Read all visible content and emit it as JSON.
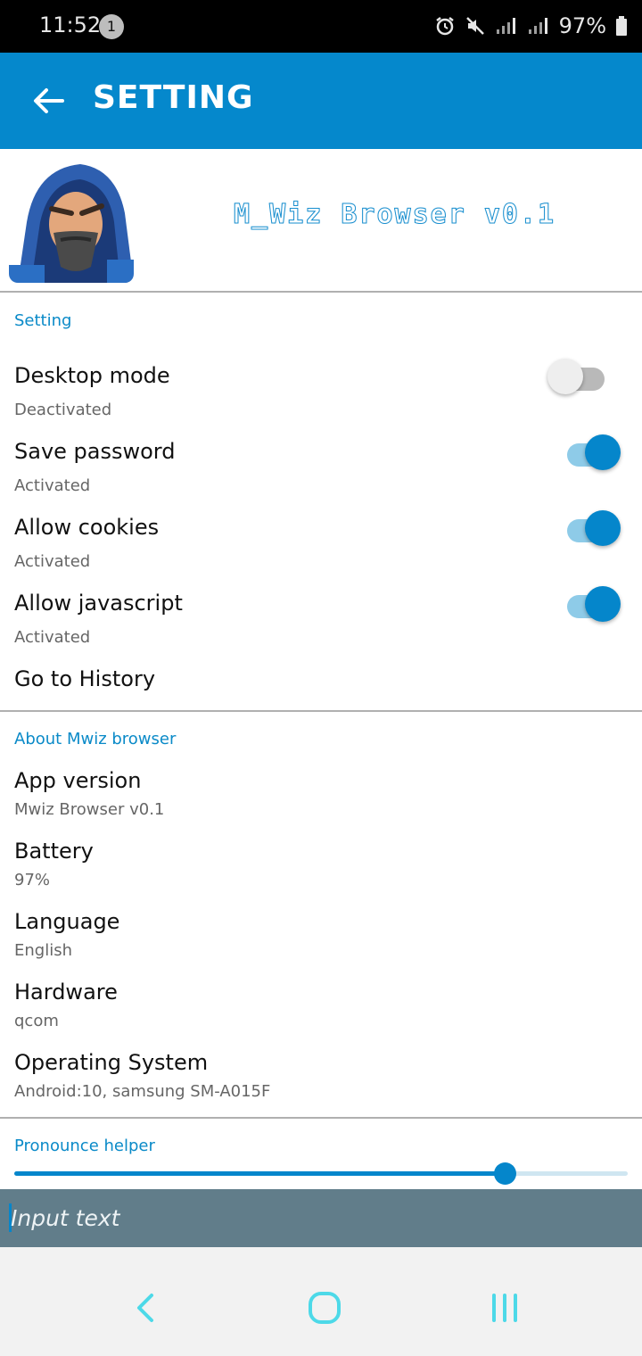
{
  "status_bar": {
    "time": "11:52",
    "notification_count": "1",
    "battery_text": "97%",
    "icons": [
      "alarm-icon",
      "mute-icon",
      "signal-icon",
      "signal-icon",
      "battery-icon"
    ]
  },
  "app_bar": {
    "title": "SETTING",
    "back_icon": "arrow-left-icon",
    "color": "#0588cc"
  },
  "header": {
    "brand_name": "M_Wiz Browser",
    "brand_version": "v0.1"
  },
  "settings_section": {
    "title": "Setting",
    "items": [
      {
        "title": "Desktop mode",
        "subtitle": "Deactivated",
        "enabled": false
      },
      {
        "title": "Save password",
        "subtitle": "Activated",
        "enabled": true
      },
      {
        "title": "Allow cookies",
        "subtitle": "Activated",
        "enabled": true
      },
      {
        "title": "Allow javascript",
        "subtitle": "Activated",
        "enabled": true
      }
    ],
    "history_label": "Go to History"
  },
  "about_section": {
    "title": "About Mwiz browser",
    "items": [
      {
        "title": "App version",
        "value": "Mwiz Browser v0.1"
      },
      {
        "title": "Battery",
        "value": "97%"
      },
      {
        "title": "Language",
        "value": "English"
      },
      {
        "title": "Hardware",
        "value": "qcom"
      },
      {
        "title": "Operating System",
        "value": "Android:10, samsung SM-A015F"
      }
    ]
  },
  "pronounce_section": {
    "title": "Pronounce helper",
    "slider_value": 0.8
  },
  "input": {
    "placeholder": "Input text",
    "value": ""
  },
  "nav_bar": {
    "icons": [
      "back-nav-icon",
      "home-nav-icon",
      "recents-nav-icon"
    ],
    "color": "#4dd9e8"
  },
  "colors": {
    "accent": "#0586cb",
    "input_bg": "#617d8a"
  }
}
